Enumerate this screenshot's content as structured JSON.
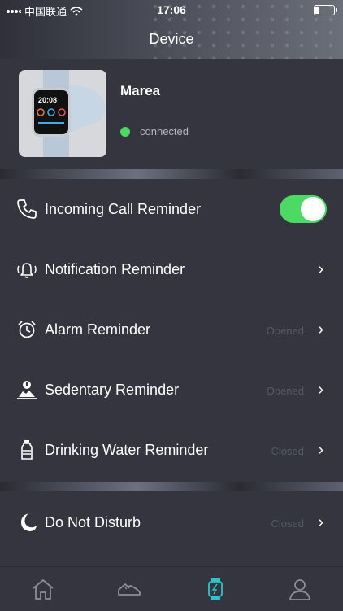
{
  "status_bar": {
    "carrier": "中国联通",
    "time": "17:06"
  },
  "header": {
    "title": "Device"
  },
  "device": {
    "name": "Marea",
    "connection": "connected",
    "watch_time": "20:08"
  },
  "reminders": [
    {
      "label": "Incoming Call Reminder",
      "icon": "phone-icon",
      "toggle": true
    },
    {
      "label": "Notification Reminder",
      "icon": "bell-icon",
      "status": ""
    },
    {
      "label": "Alarm Reminder",
      "icon": "alarm-clock-icon",
      "status": "Opened"
    },
    {
      "label": "Sedentary Reminder",
      "icon": "sedentary-icon",
      "status": "Opened"
    },
    {
      "label": "Drinking Water Reminder",
      "icon": "water-bottle-icon",
      "status": "Closed"
    }
  ],
  "dnd": {
    "label": "Do Not Disturb",
    "icon": "moon-icon",
    "status": "Closed"
  },
  "tabs": [
    {
      "icon": "home-icon",
      "active": false
    },
    {
      "icon": "shoe-icon",
      "active": false
    },
    {
      "icon": "watch-icon",
      "active": true
    },
    {
      "icon": "profile-icon",
      "active": false
    }
  ],
  "colors": {
    "accent": "#4cd964",
    "active_tab": "#2bc4c9",
    "background": "#34353f"
  }
}
